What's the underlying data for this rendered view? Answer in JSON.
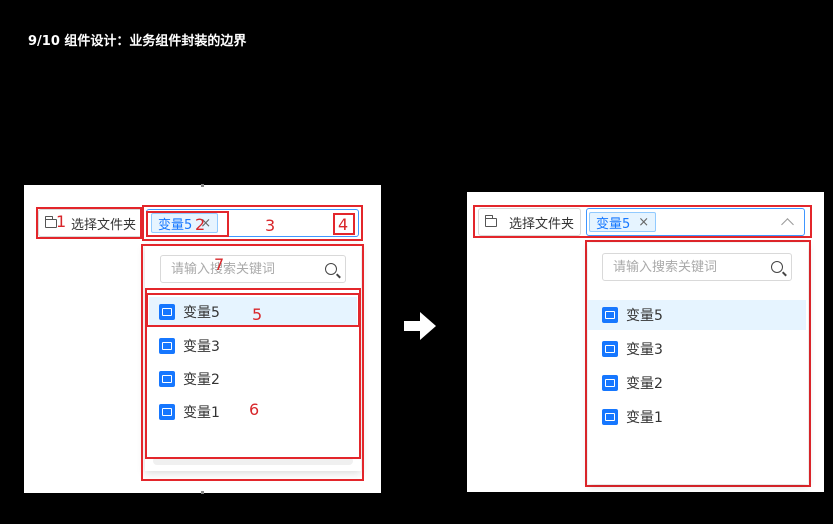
{
  "slide": {
    "title": "9/10  组件设计：业务组件封装的边界"
  },
  "left": {
    "folder_label": "选择文件夹",
    "tag_label": "变量5",
    "tag_close": "×",
    "search_placeholder": "请输入搜索关键词",
    "items": [
      "变量5",
      "变量3",
      "变量2",
      "变量1"
    ],
    "selected_index": 0,
    "annotations": [
      "1",
      "2",
      "3",
      "4",
      "5",
      "6",
      "7"
    ]
  },
  "right": {
    "folder_label": "选择文件夹",
    "tag_label": "变量5",
    "tag_close": "×",
    "search_placeholder": "请输入搜索关键词",
    "items": [
      "变量5",
      "变量3",
      "变量2",
      "变量1"
    ],
    "selected_index": 0
  },
  "colors": {
    "background": "#000000",
    "annotation_red": "#e3262b",
    "primary_blue": "#1677ff",
    "selected_bg": "#e6f4ff"
  },
  "icons": [
    "folder-icon",
    "search-icon",
    "variable-icon",
    "close-icon",
    "chevron-up-icon",
    "right-arrow-icon"
  ]
}
